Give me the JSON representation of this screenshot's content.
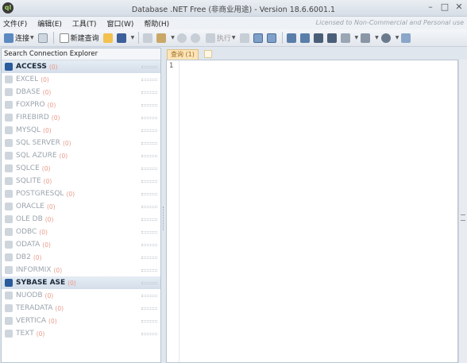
{
  "window": {
    "title": "Database .NET Free (非商业用途) - Version 18.6.6001.1",
    "app_icon_glyph": "ql",
    "controls": {
      "minimize": "–",
      "maximize": "□",
      "close": "✕"
    }
  },
  "menu": {
    "items": [
      "文件(F)",
      "编辑(E)",
      "工具(T)",
      "窗口(W)",
      "帮助(H)"
    ],
    "license_note": "Licensed to Non-Commercial and Personal use"
  },
  "toolbar": {
    "connect_label": "连接",
    "new_query_label": "新建查询",
    "execute_label": "执行",
    "icons": [
      "connect-icon",
      "refresh-icon",
      "new-query-icon",
      "open-folder-icon",
      "save-icon",
      "cut-icon",
      "paste-icon",
      "undo-icon",
      "redo-icon",
      "execute-icon",
      "check-icon",
      "grid-icon",
      "grid2-icon",
      "align-icon",
      "sort-icon",
      "list-icon",
      "list2-icon",
      "table-icon",
      "export-icon",
      "settings-icon",
      "help-icon"
    ]
  },
  "explorer": {
    "header": "Search Connection Explorer",
    "items": [
      {
        "name": "ACCESS",
        "count": "(0)",
        "active": true,
        "icon": "access-icon"
      },
      {
        "name": "EXCEL",
        "count": "(0)",
        "active": false,
        "icon": "excel-icon"
      },
      {
        "name": "DBASE",
        "count": "(0)",
        "active": false,
        "icon": "dbase-icon"
      },
      {
        "name": "FOXPRO",
        "count": "(0)",
        "active": false,
        "icon": "foxpro-icon"
      },
      {
        "name": "FIREBIRD",
        "count": "(0)",
        "active": false,
        "icon": "firebird-icon"
      },
      {
        "name": "MYSQL",
        "count": "(0)",
        "active": false,
        "icon": "mysql-icon"
      },
      {
        "name": "SQL SERVER",
        "count": "(0)",
        "active": false,
        "icon": "sqlserver-icon"
      },
      {
        "name": "SQL AZURE",
        "count": "(0)",
        "active": false,
        "icon": "sqlazure-icon"
      },
      {
        "name": "SQLCE",
        "count": "(0)",
        "active": false,
        "icon": "sqlce-icon"
      },
      {
        "name": "SQLITE",
        "count": "(0)",
        "active": false,
        "icon": "sqlite-icon"
      },
      {
        "name": "POSTGRESQL",
        "count": "(0)",
        "active": false,
        "icon": "postgresql-icon"
      },
      {
        "name": "ORACLE",
        "count": "(0)",
        "active": false,
        "icon": "oracle-icon"
      },
      {
        "name": "OLE DB",
        "count": "(0)",
        "active": false,
        "icon": "oledb-icon"
      },
      {
        "name": "ODBC",
        "count": "(0)",
        "active": false,
        "icon": "odbc-icon"
      },
      {
        "name": "ODATA",
        "count": "(0)",
        "active": false,
        "icon": "odata-icon"
      },
      {
        "name": "DB2",
        "count": "(0)",
        "active": false,
        "icon": "db2-icon"
      },
      {
        "name": "INFORMIX",
        "count": "(0)",
        "active": false,
        "icon": "informix-icon"
      },
      {
        "name": "SYBASE ASE",
        "count": "(0)",
        "active": true,
        "icon": "sybase-icon"
      },
      {
        "name": "NUODB",
        "count": "(0)",
        "active": false,
        "icon": "nuodb-icon"
      },
      {
        "name": "TERADATA",
        "count": "(0)",
        "active": false,
        "icon": "teradata-icon"
      },
      {
        "name": "VERTICA",
        "count": "(0)",
        "active": false,
        "icon": "vertica-icon"
      },
      {
        "name": "TEXT",
        "count": "(0)",
        "active": false,
        "icon": "text-icon"
      }
    ]
  },
  "editor": {
    "tab_label": "查询 (1)",
    "line_numbers": [
      "1"
    ]
  },
  "colors": {
    "accent": "#2a5b9b",
    "tab_active": "#fde5b8",
    "count_color": "#e89a8a"
  }
}
